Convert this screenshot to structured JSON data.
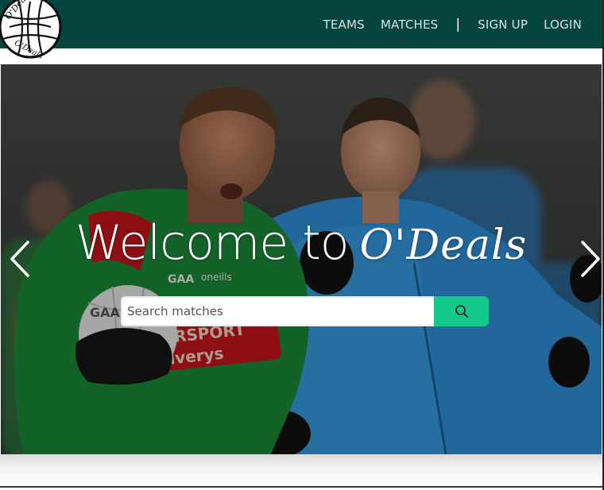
{
  "brand": {
    "logo_text": "O'Deals",
    "logo_icon": "gaelic-football-icon"
  },
  "nav": {
    "items": [
      {
        "label": "TEAMS"
      },
      {
        "label": "MATCHES"
      },
      {
        "label": "SIGN UP"
      },
      {
        "label": "LOGIN"
      }
    ],
    "separator": "|"
  },
  "hero": {
    "title_prefix": "Welcome to",
    "title_brand": "O'Deals",
    "background": "gaelic-football-players-photo",
    "prev_icon": "chevron-left-icon",
    "next_icon": "chevron-right-icon"
  },
  "search": {
    "placeholder": "Search matches",
    "value": "",
    "button_icon": "search-icon"
  },
  "colors": {
    "navbar": "#05443f",
    "search_button": "#12c98a",
    "mayo_green": "#1b8a3a",
    "mayo_red": "#c4161c",
    "dublin_blue": "#2f8fd8"
  }
}
